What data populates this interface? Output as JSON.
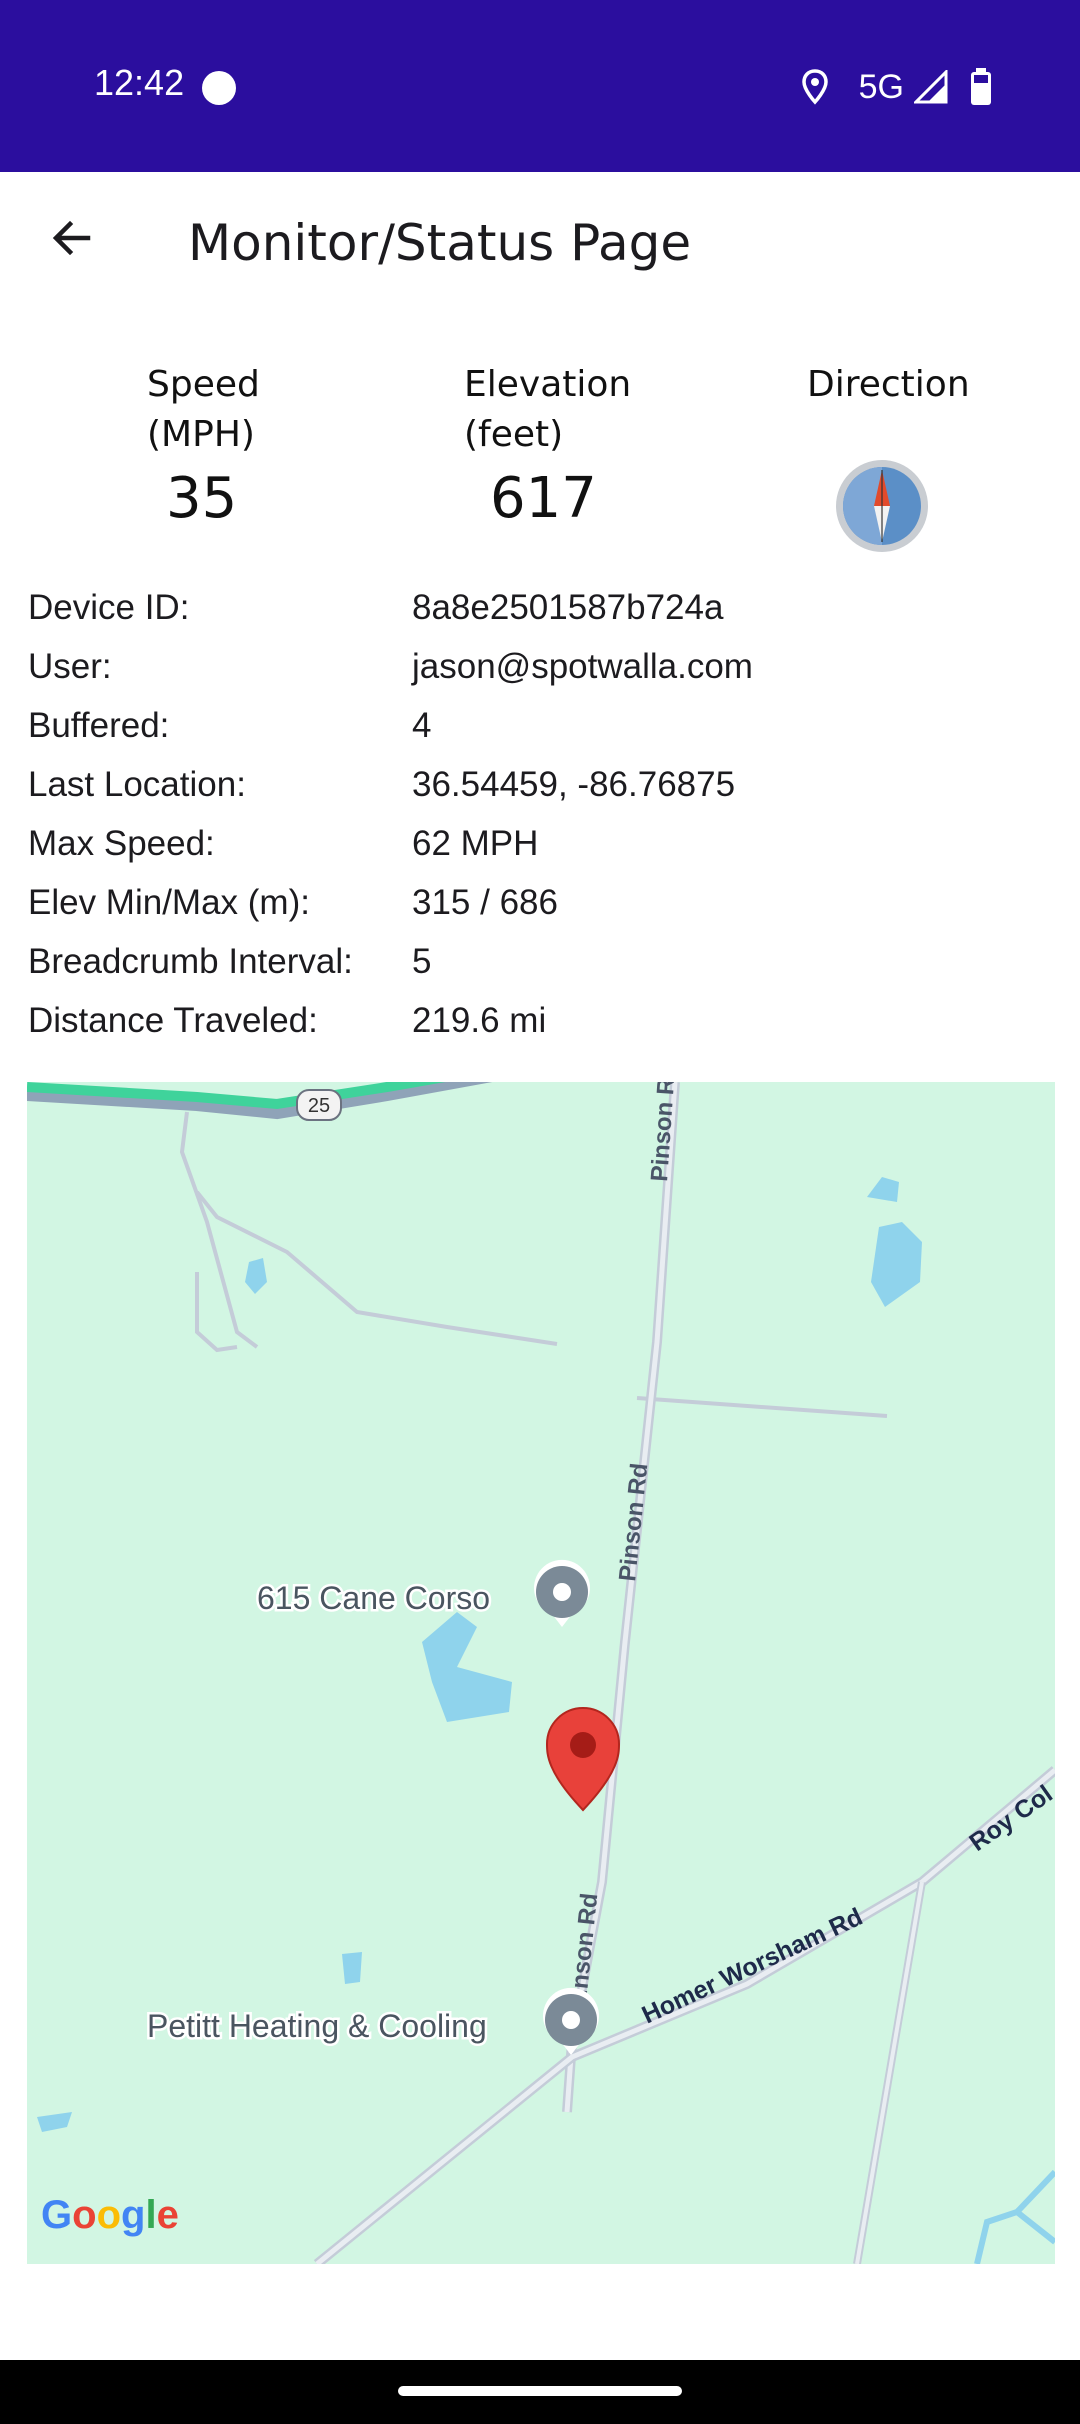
{
  "status_bar": {
    "time": "12:42",
    "network": "5G",
    "icons": [
      "notification-dot-icon",
      "location-icon",
      "signal-icon",
      "battery-icon"
    ]
  },
  "app_bar": {
    "title": "Monitor/Status Page",
    "back_icon": "arrow-left-icon"
  },
  "metrics": {
    "speed": {
      "label_line1": "Speed",
      "label_line2": "(MPH)",
      "value": "35"
    },
    "elevation": {
      "label_line1": "Elevation",
      "label_line2": "(feet)",
      "value": "617"
    },
    "direction": {
      "label": "Direction",
      "icon": "compass-icon"
    }
  },
  "info": [
    {
      "label": "Device ID:",
      "value": "8a8e2501587b724a"
    },
    {
      "label": "User:",
      "value": "jason@spotwalla.com"
    },
    {
      "label": "Buffered:",
      "value": "4"
    },
    {
      "label": "Last Location:",
      "value": "36.54459, -86.76875"
    },
    {
      "label": "Max Speed:",
      "value": "62 MPH"
    },
    {
      "label": "Elev Min/Max (m):",
      "value": "315 / 686"
    },
    {
      "label": "Breadcrumb Interval:",
      "value": "5"
    },
    {
      "label": "Distance Traveled:",
      "value": "219.6 mi"
    }
  ],
  "map": {
    "colors": {
      "land": "#d2f6e3",
      "water": "#8fd3ec",
      "road": "#c4ccd8",
      "highway": "#3fd39b",
      "marker": "#e8413a"
    },
    "labels": {
      "route_shield": "25",
      "road_pinson_top": "Pinson R",
      "road_pinson_mid": "Pinson Rd",
      "road_pinson_low": "Pinson Rd",
      "road_homer": "Homer Worsham Rd",
      "road_roy": "Roy Col",
      "poi_cane_corso": "615 Cane Corso",
      "poi_petitt": "Petitt Heating & Cooling",
      "attribution": "Google"
    }
  }
}
